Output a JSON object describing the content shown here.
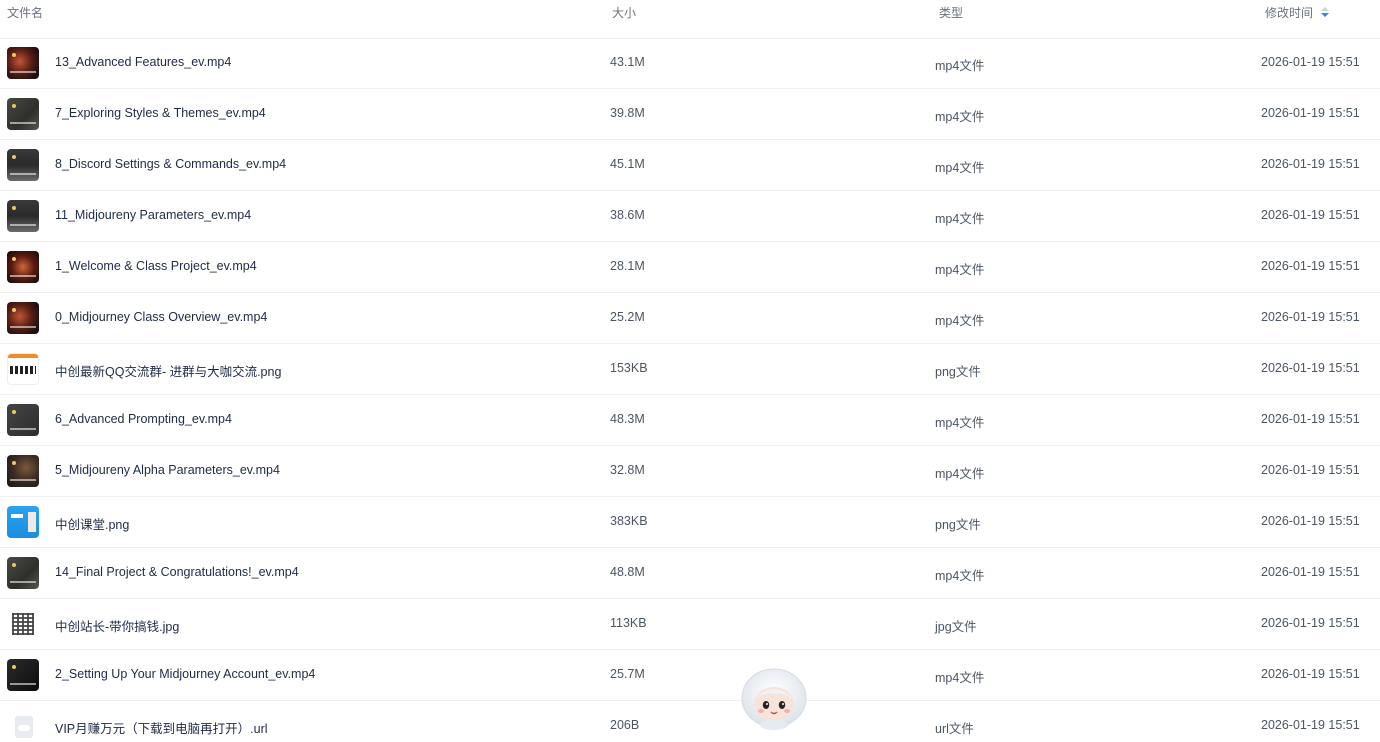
{
  "columns": {
    "name": "文件名",
    "size": "大小",
    "type": "类型",
    "modified": "修改时间"
  },
  "sort": {
    "column": "modified",
    "direction": "desc"
  },
  "files": [
    {
      "name": "13_Advanced Features_ev.mp4",
      "size": "43.1M",
      "type": "mp4文件",
      "modified": "2026-01-19 15:51",
      "thumb": "video-a"
    },
    {
      "name": "7_Exploring Styles & Themes_ev.mp4",
      "size": "39.8M",
      "type": "mp4文件",
      "modified": "2026-01-19 15:51",
      "thumb": "video-b"
    },
    {
      "name": "8_Discord Settings & Commands_ev.mp4",
      "size": "45.1M",
      "type": "mp4文件",
      "modified": "2026-01-19 15:51",
      "thumb": "video-c"
    },
    {
      "name": "11_Midjoureny Parameters_ev.mp4",
      "size": "38.6M",
      "type": "mp4文件",
      "modified": "2026-01-19 15:51",
      "thumb": "video-c"
    },
    {
      "name": "1_Welcome & Class Project_ev.mp4",
      "size": "28.1M",
      "type": "mp4文件",
      "modified": "2026-01-19 15:51",
      "thumb": "video-e"
    },
    {
      "name": "0_Midjourney Class Overview_ev.mp4",
      "size": "25.2M",
      "type": "mp4文件",
      "modified": "2026-01-19 15:51",
      "thumb": "video-a"
    },
    {
      "name": "中创最新QQ交流群- 进群与大咖交流.png",
      "size": "153KB",
      "type": "png文件",
      "modified": "2026-01-19 15:51",
      "thumb": "png-qr"
    },
    {
      "name": "6_Advanced Prompting_ev.mp4",
      "size": "48.3M",
      "type": "mp4文件",
      "modified": "2026-01-19 15:51",
      "thumb": "video-f"
    },
    {
      "name": "5_Midjoureny Alpha Parameters_ev.mp4",
      "size": "32.8M",
      "type": "mp4文件",
      "modified": "2026-01-19 15:51",
      "thumb": "video-d"
    },
    {
      "name": "中创课堂.png",
      "size": "383KB",
      "type": "png文件",
      "modified": "2026-01-19 15:51",
      "thumb": "png-blue"
    },
    {
      "name": "14_Final Project & Congratulations!_ev.mp4",
      "size": "48.8M",
      "type": "mp4文件",
      "modified": "2026-01-19 15:51",
      "thumb": "video-b"
    },
    {
      "name": "中创站长-带你搞钱.jpg",
      "size": "113KB",
      "type": "jpg文件",
      "modified": "2026-01-19 15:51",
      "thumb": "jpg-qr"
    },
    {
      "name": "2_Setting Up Your Midjourney Account_ev.mp4",
      "size": "25.7M",
      "type": "mp4文件",
      "modified": "2026-01-19 15:51",
      "thumb": "video-g"
    },
    {
      "name": "VIP月赚万元（下载到电脑再打开）.url",
      "size": "206B",
      "type": "url文件",
      "modified": "2026-01-19 15:51",
      "thumb": "url-icon"
    }
  ]
}
